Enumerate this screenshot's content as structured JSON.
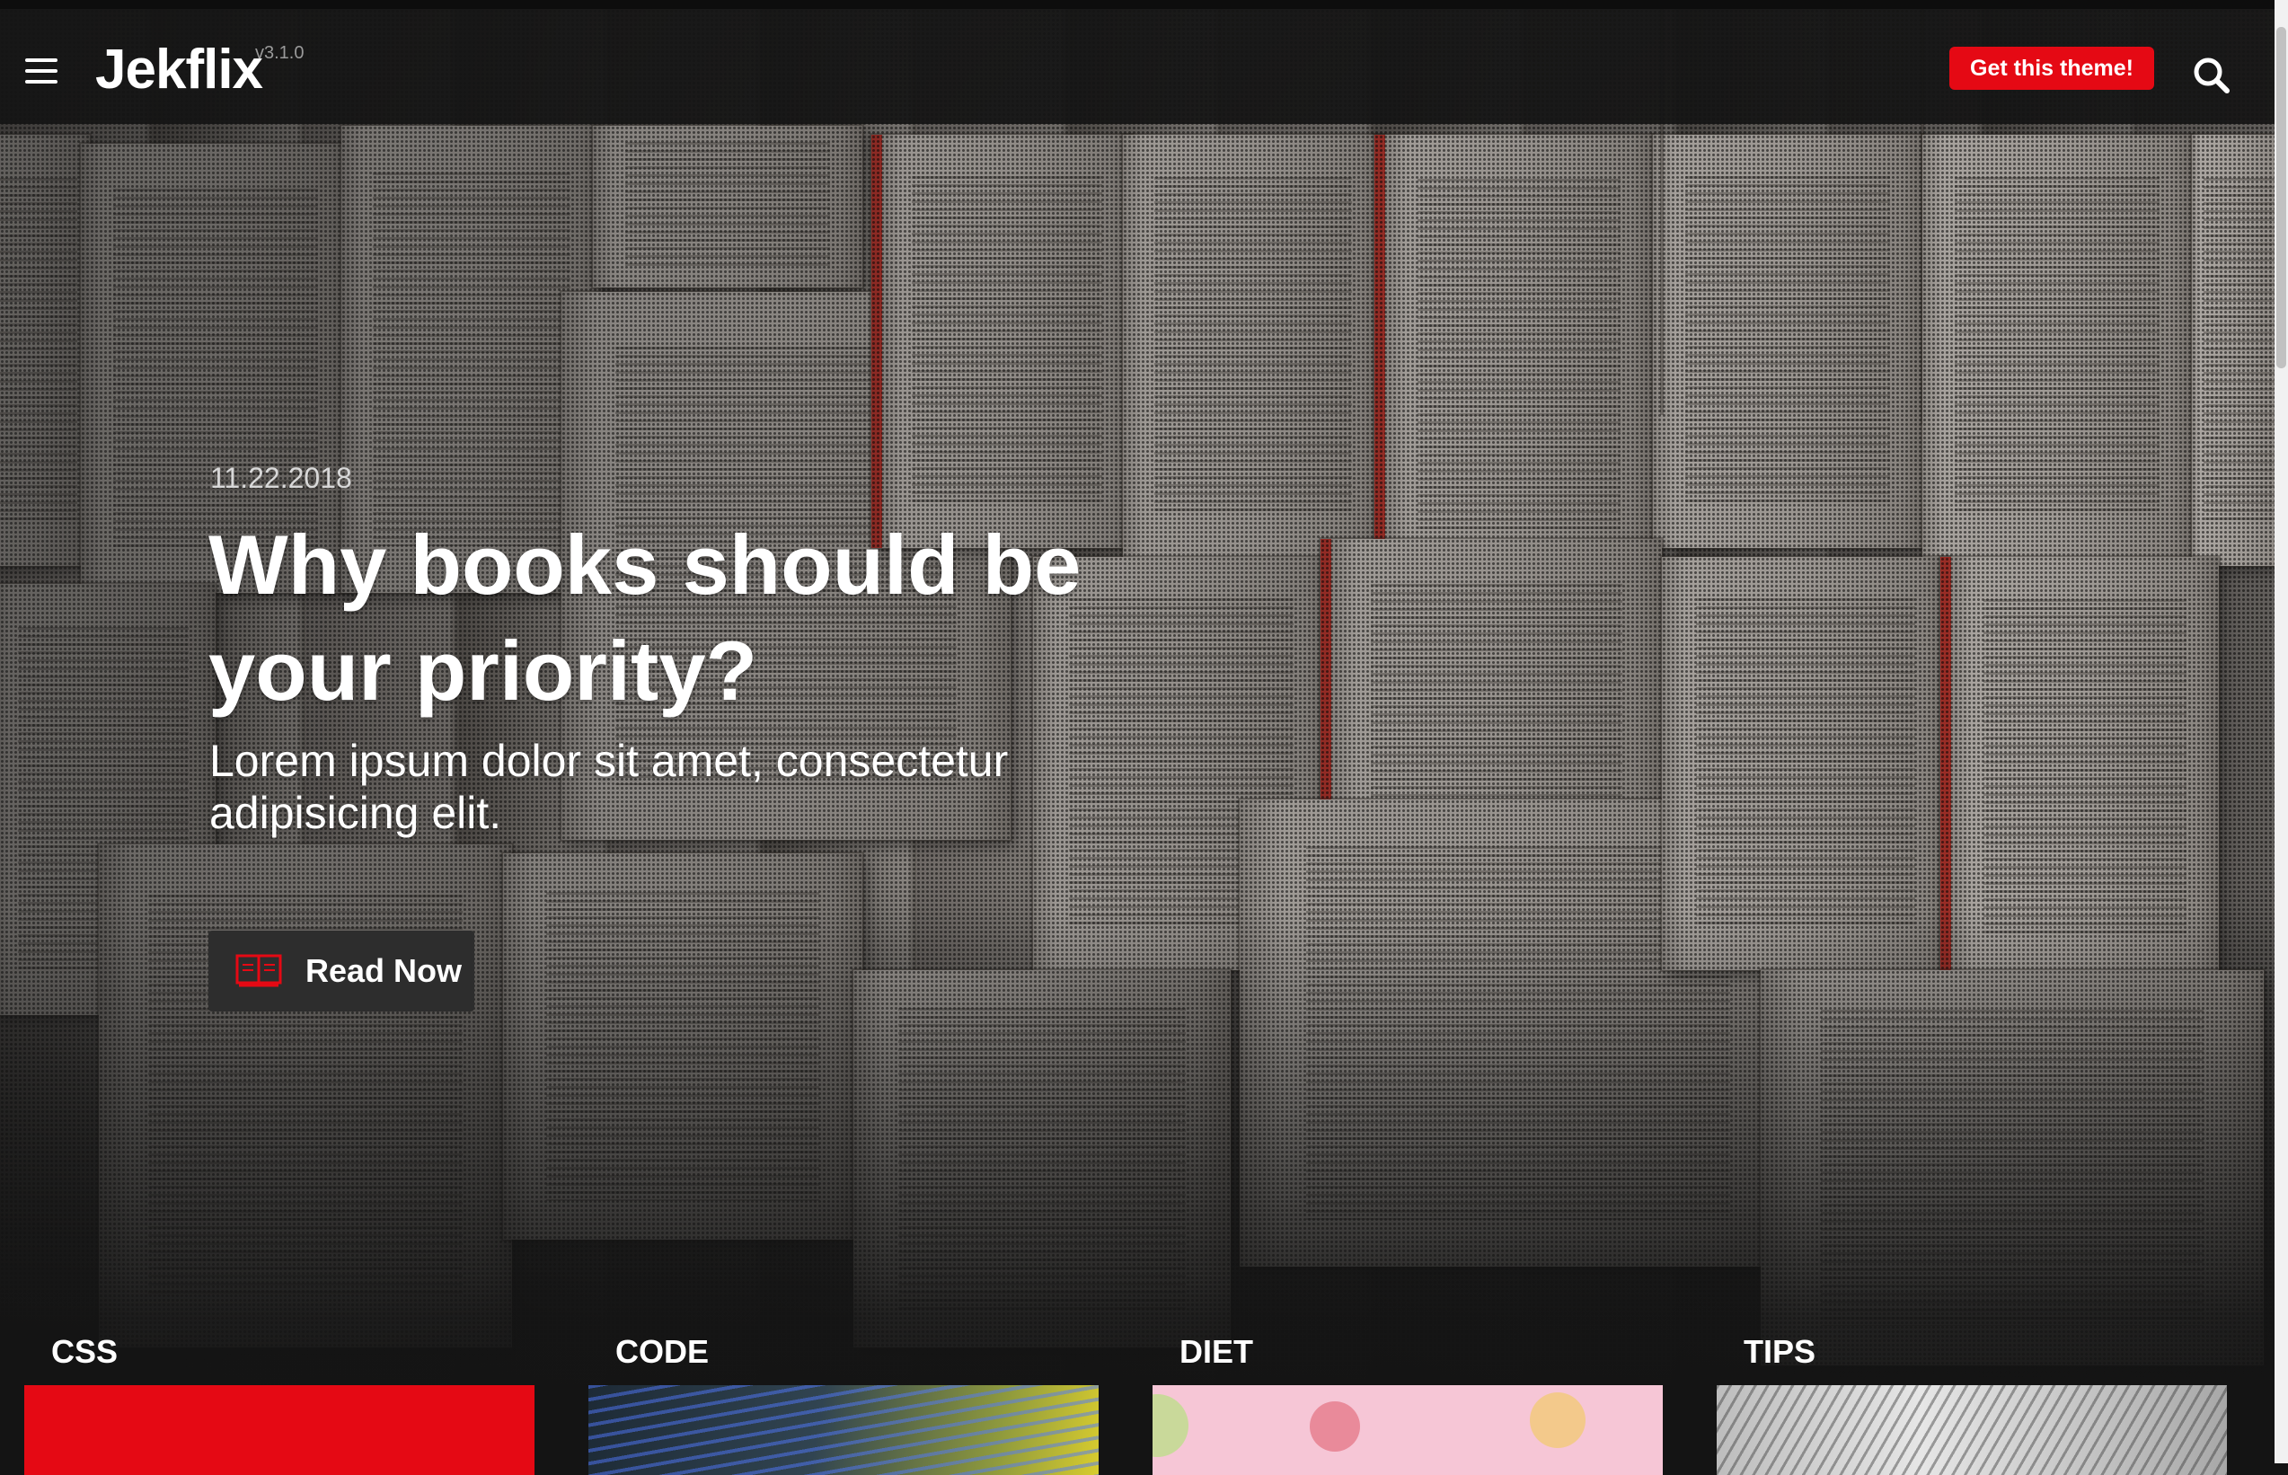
{
  "header": {
    "logo": "Jekflix",
    "version": "v3.1.0",
    "cta_label": "Get this theme!",
    "icons": {
      "menu": "hamburger-menu-icon",
      "search": "search-icon"
    }
  },
  "hero": {
    "date": "11.22.2018",
    "title": "Why books should be your priority?",
    "description": "Lorem ipsum dolor sit amet, consectetur adipisicing elit.",
    "button_label": "Read Now",
    "button_icon": "book-icon"
  },
  "categories": [
    {
      "label": "CSS"
    },
    {
      "label": "CODE"
    },
    {
      "label": "DIET"
    },
    {
      "label": "TIPS"
    }
  ],
  "colors": {
    "accent": "#e50914",
    "background": "#141414",
    "button_dark": "#2d2d2d"
  }
}
